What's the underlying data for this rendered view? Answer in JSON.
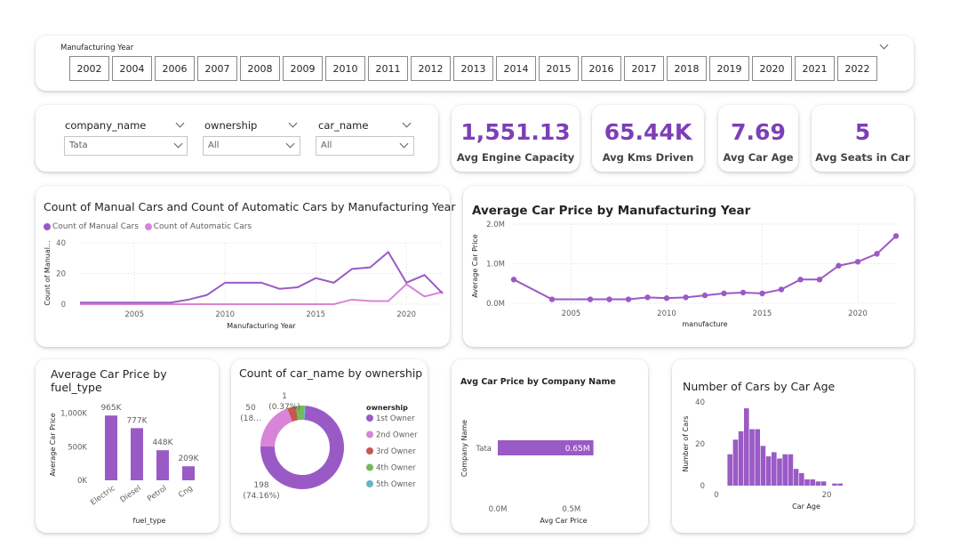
{
  "year_slicer": {
    "label": "Manufacturing Year",
    "years": [
      "2002",
      "2004",
      "2006",
      "2007",
      "2008",
      "2009",
      "2010",
      "2011",
      "2012",
      "2013",
      "2014",
      "2015",
      "2016",
      "2017",
      "2018",
      "2019",
      "2020",
      "2021",
      "2022"
    ]
  },
  "filters": {
    "company": {
      "label": "company_name",
      "value": "Tata"
    },
    "ownership": {
      "label": "ownership",
      "value": "All"
    },
    "car": {
      "label": "car_name",
      "value": "All"
    }
  },
  "kpis": [
    {
      "value": "1,551.13",
      "label": "Avg Engine Capacity"
    },
    {
      "value": "65.44K",
      "label": "Avg Kms Driven"
    },
    {
      "value": "7.69",
      "label": "Avg Car Age"
    },
    {
      "value": "5",
      "label": "Avg Seats in Car"
    }
  ],
  "colors": {
    "accent": "#7d3fb7",
    "manual": "#9a5ac6",
    "automatic": "#d884d8"
  },
  "chart_data": [
    {
      "type": "line",
      "title": "Count of Manual Cars and Count of Automatic Cars by Manufacturing Year",
      "xlabel": "Manufacturing Year",
      "ylabel": "Count of Manual...",
      "x": [
        2002,
        2004,
        2006,
        2007,
        2008,
        2009,
        2010,
        2011,
        2012,
        2013,
        2014,
        2015,
        2016,
        2017,
        2018,
        2019,
        2020,
        2021,
        2022
      ],
      "series": [
        {
          "name": "Count of Manual Cars",
          "values": [
            1,
            1,
            1,
            1,
            3,
            6,
            14,
            14,
            14,
            10,
            11,
            17,
            14,
            23,
            24,
            34,
            14,
            19,
            7
          ]
        },
        {
          "name": "Count of Automatic Cars",
          "values": [
            0,
            0,
            0,
            0,
            0,
            0,
            0,
            0,
            0,
            0,
            0,
            0,
            0,
            3,
            2,
            2,
            13,
            5,
            8
          ]
        }
      ],
      "xticks": [
        "2005",
        "2010",
        "2015",
        "2020"
      ],
      "yticks": [
        "0",
        "20",
        "40"
      ],
      "ylim": [
        0,
        40
      ],
      "grid": true
    },
    {
      "type": "line",
      "title": "Average Car Price by Manufacturing Year",
      "xlabel": "manufacture",
      "ylabel": "Average Car Price",
      "x": [
        2002,
        2004,
        2006,
        2007,
        2008,
        2009,
        2010,
        2011,
        2012,
        2013,
        2014,
        2015,
        2016,
        2017,
        2018,
        2019,
        2020,
        2021,
        2022
      ],
      "series": [
        {
          "values": [
            0.6,
            0.1,
            0.1,
            0.1,
            0.1,
            0.15,
            0.13,
            0.15,
            0.2,
            0.25,
            0.27,
            0.25,
            0.35,
            0.6,
            0.6,
            0.95,
            1.05,
            1.25,
            1.7
          ]
        }
      ],
      "xticks": [
        "2005",
        "2010",
        "2015",
        "2020"
      ],
      "yticks": [
        "0.0M",
        "1.0M",
        "2.0M"
      ],
      "ylim": [
        0,
        2.0
      ],
      "grid": true
    },
    {
      "type": "bar",
      "title": "Average Car Price by fuel_type",
      "xlabel": "fuel_type",
      "ylabel": "Average Car Price",
      "categories": [
        "Electric",
        "Diesel",
        "Petrol",
        "Cng"
      ],
      "values": [
        965000,
        777000,
        448000,
        209000
      ],
      "labels": [
        "965K",
        "777K",
        "448K",
        "209K"
      ],
      "yticks": [
        "0K",
        "500K",
        "1,000K"
      ],
      "ylim": [
        0,
        1100000
      ]
    },
    {
      "type": "pie",
      "title": "Count of car_name by ownership",
      "legend_title": "ownership",
      "categories": [
        "1st Owner",
        "2nd Owner",
        "3rd Owner",
        "4th Owner",
        "5th Owner"
      ],
      "values": [
        198,
        50,
        9,
        9,
        1
      ],
      "colors": [
        "#9a5ac6",
        "#d884d8",
        "#c45a4f",
        "#74b95a",
        "#66b4c4"
      ],
      "labels": [
        "198\n(74.16%)",
        "50\n(18...",
        "1\n(0.37%)"
      ]
    },
    {
      "type": "bar",
      "title": "Avg Car Price by Company Name",
      "xlabel": "Avg Car Price",
      "ylabel": "Company Name",
      "categories": [
        "Tata"
      ],
      "values": [
        0.65
      ],
      "labels": [
        "0.65M"
      ],
      "xticks": [
        "0.0M",
        "0.5M"
      ],
      "xlim": [
        0,
        0.9
      ]
    },
    {
      "type": "bar",
      "title": "Number of Cars by Car Age",
      "xlabel": "Car Age",
      "ylabel": "Number of Cars",
      "categories": [
        2,
        3,
        4,
        5,
        6,
        7,
        8,
        9,
        10,
        11,
        12,
        13,
        14,
        15,
        16,
        17,
        18,
        19,
        20,
        21,
        22
      ],
      "values": [
        15,
        22,
        26,
        37,
        27,
        27,
        19,
        14,
        16,
        13,
        15,
        15,
        8,
        6,
        3,
        3,
        2,
        2,
        0,
        1,
        1
      ],
      "xticks": [
        "0",
        "20"
      ],
      "yticks": [
        "0",
        "20",
        "40"
      ],
      "ylim": [
        0,
        40
      ]
    }
  ]
}
